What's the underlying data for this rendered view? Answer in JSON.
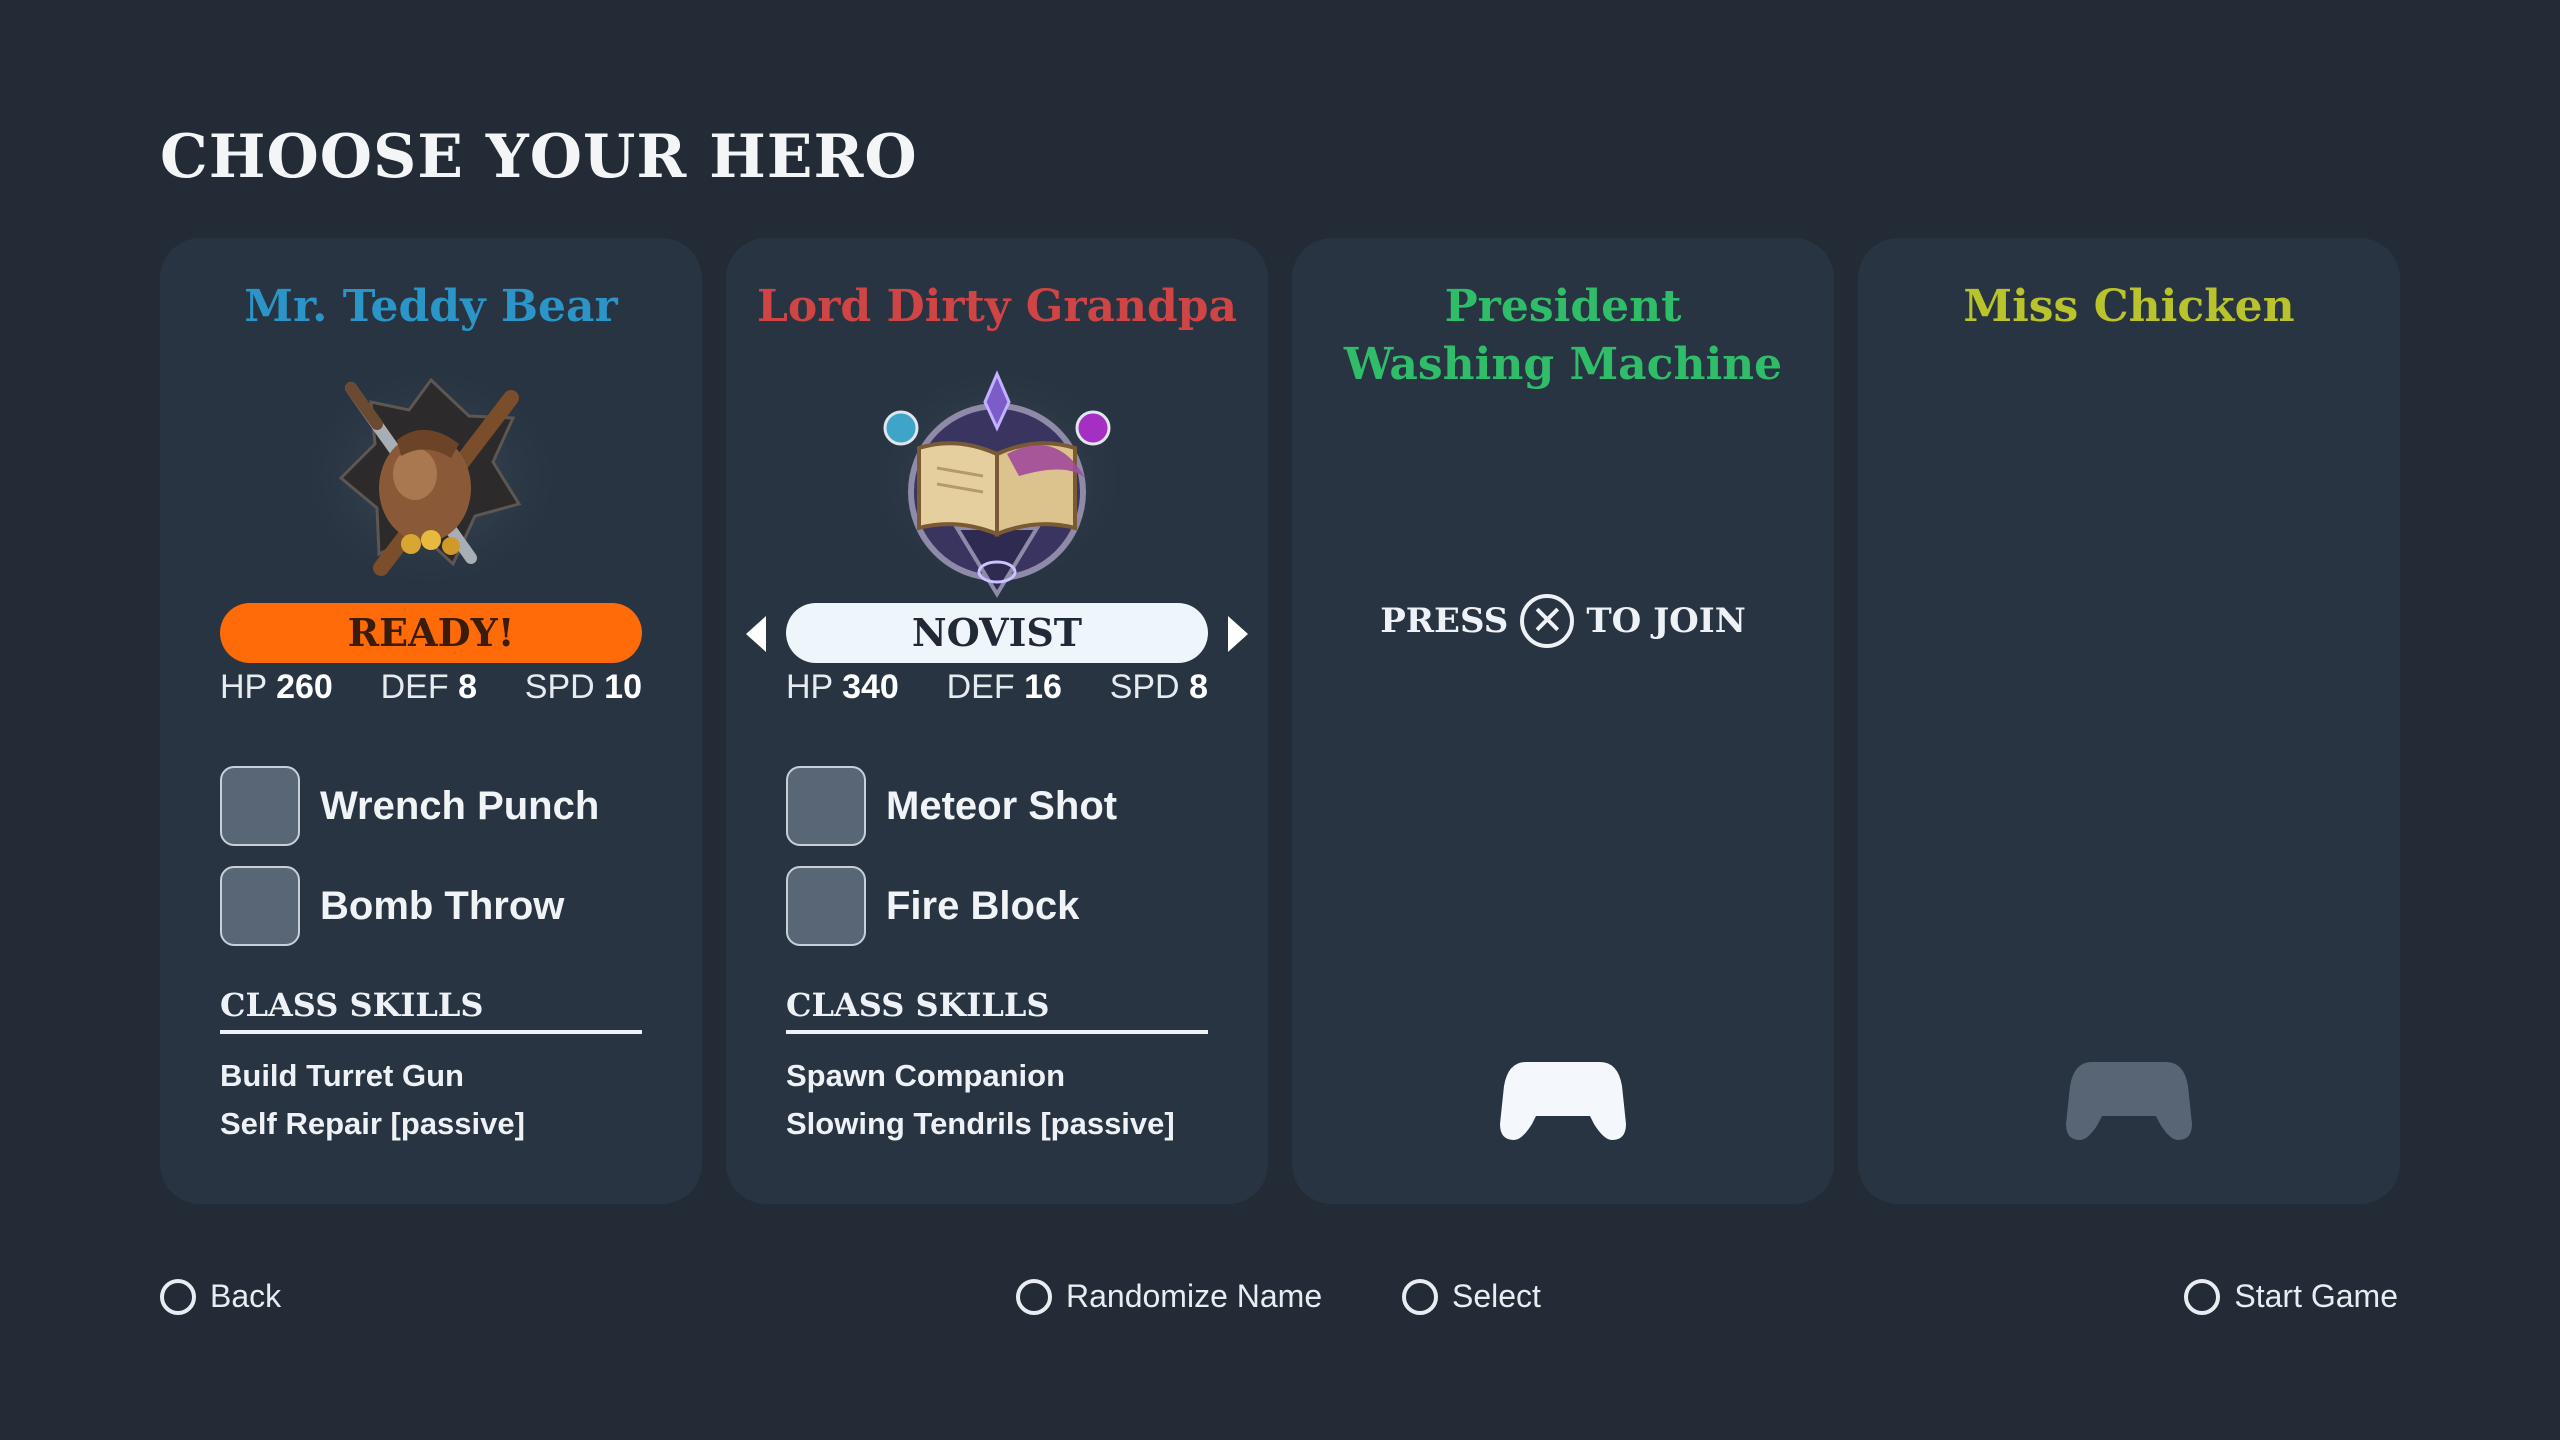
{
  "title": "CHOOSE YOUR HERO",
  "colors": {
    "background": "#222b36",
    "card": "#283441",
    "ready_pill": "#ff6b09",
    "controller_active": "#f4f8fc",
    "controller_inactive": "#586575"
  },
  "cards": [
    {
      "name": "Mr. Teddy Bear",
      "name_color": "#2a95c6",
      "icon": "sword-wrench-sack-emblem-icon",
      "status": "READY!",
      "stats": {
        "hp_label": "HP",
        "hp": "260",
        "def_label": "DEF",
        "def": "8",
        "spd_label": "SPD",
        "spd": "10"
      },
      "skills": [
        "Wrench Punch",
        "Bomb Throw"
      ],
      "class_skills_heading": "CLASS SKILLS",
      "class_skills": [
        "Build Turret Gun",
        "Self Repair [passive]"
      ]
    },
    {
      "name": "Lord Dirty Grandpa",
      "name_color": "#cf4545",
      "icon": "spellbook-emblem-icon",
      "class_name": "NOVIST",
      "stats": {
        "hp_label": "HP",
        "hp": "340",
        "def_label": "DEF",
        "def": "16",
        "spd_label": "SPD",
        "spd": "8"
      },
      "skills": [
        "Meteor Shot",
        "Fire Block"
      ],
      "class_skills_heading": "CLASS SKILLS",
      "class_skills": [
        "Spawn Companion",
        "Slowing Tendrils [passive]"
      ]
    },
    {
      "name": "President Washing Machine",
      "name_color": "#2fbd6a",
      "join_press": "PRESS",
      "join_button": "✕",
      "join_suffix": "TO JOIN",
      "controller_icon": "gamepad-icon",
      "controller_state": "connected"
    },
    {
      "name": "Miss Chicken",
      "name_color": "#b9c32b",
      "controller_icon": "gamepad-icon",
      "controller_state": "disconnected"
    }
  ],
  "footer": {
    "back": "Back",
    "randomize": "Randomize Name",
    "select": "Select",
    "start": "Start Game"
  }
}
